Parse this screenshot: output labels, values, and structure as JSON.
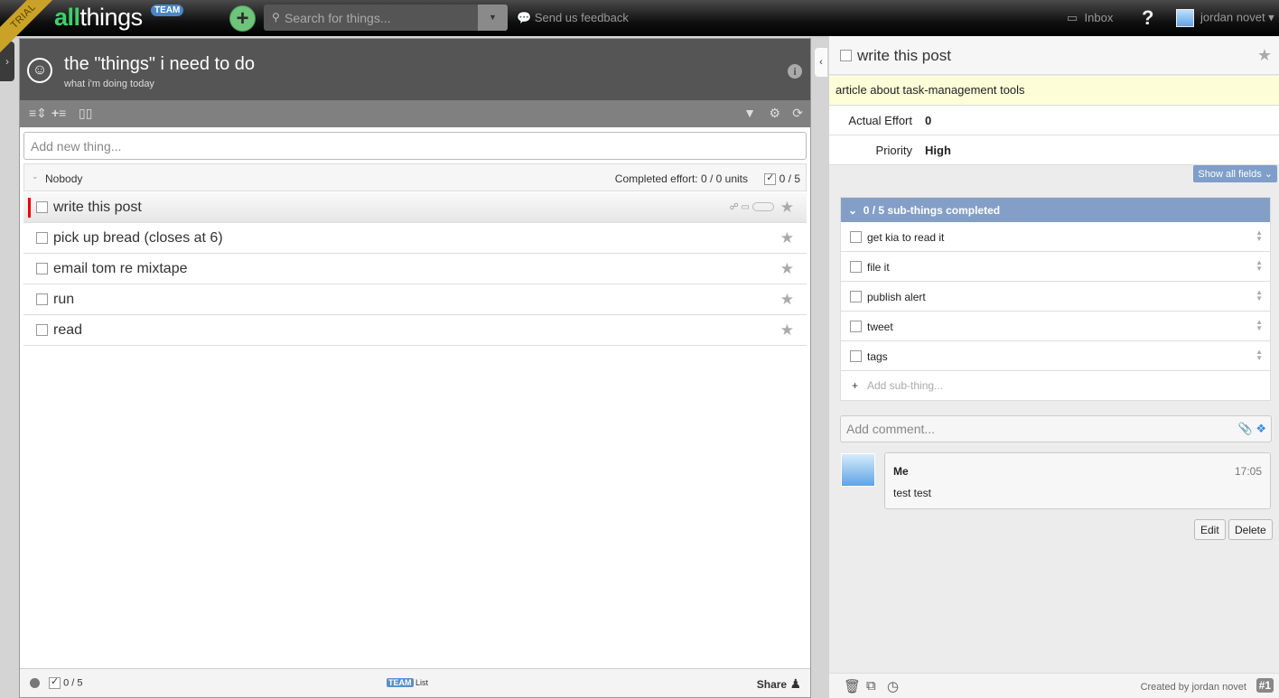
{
  "topbar": {
    "trial_label": "TRIAL",
    "logo_all": "all",
    "logo_things": "things",
    "team_badge": "TEAM",
    "add_icon": "+",
    "search_placeholder": "Search for things...",
    "feedback_label": "Send us feedback",
    "inbox_label": "Inbox",
    "help_label": "?",
    "user_name": "jordan novet ▾"
  },
  "list": {
    "title": "the \"things\" i need to do",
    "subtitle": "what i'm doing today",
    "new_thing_placeholder": "Add new thing...",
    "group": {
      "name": "Nobody",
      "effort": "Completed effort: 0 / 0 units",
      "count": "0 / 5"
    },
    "tasks": [
      {
        "label": "write this post",
        "selected": true
      },
      {
        "label": "pick up bread (closes at 6)"
      },
      {
        "label": "email tom re mixtape"
      },
      {
        "label": "run"
      },
      {
        "label": "read"
      }
    ],
    "footer": {
      "count": "0 / 5",
      "team_badge": "TEAM",
      "list_label": "List",
      "share_label": "Share"
    }
  },
  "detail": {
    "title": "write this post",
    "note": "article about task-management tools",
    "fields": [
      {
        "key": "Actual Effort",
        "value": "0"
      },
      {
        "key": "Priority",
        "value": "High"
      }
    ],
    "show_all_fields": "Show all fields ⌄",
    "subthings_header": "0 / 5 sub-things completed",
    "subthings": [
      "get kia to read it",
      "file it",
      "publish alert",
      "tweet",
      "tags"
    ],
    "add_subthing_placeholder": "Add sub-thing...",
    "comment_placeholder": "Add comment...",
    "comment": {
      "author": "Me",
      "time": "17:05",
      "text": "test test"
    },
    "edit_label": "Edit",
    "delete_label": "Delete",
    "created_by": "Created by jordan novet",
    "item_number": "#1"
  }
}
